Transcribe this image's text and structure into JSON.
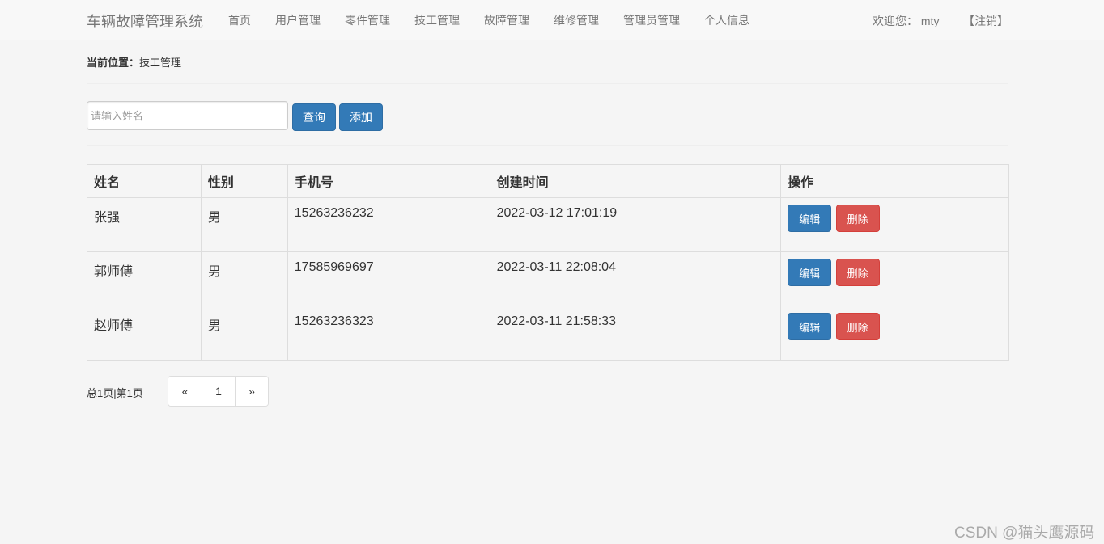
{
  "navbar": {
    "brand": "车辆故障管理系统",
    "items": [
      "首页",
      "用户管理",
      "零件管理",
      "技工管理",
      "故障管理",
      "维修管理",
      "管理员管理",
      "个人信息"
    ],
    "welcome_label": "欢迎您：",
    "username": "mty",
    "logout": "【注销】"
  },
  "breadcrumb": {
    "label": "当前位置：",
    "current": "技工管理"
  },
  "search": {
    "placeholder": "请输入姓名",
    "value": "",
    "query_label": "查询",
    "add_label": "添加"
  },
  "table": {
    "headers": [
      "姓名",
      "性别",
      "手机号",
      "创建时间",
      "操作"
    ],
    "rows": [
      {
        "name": "张强",
        "gender": "男",
        "phone": "15263236232",
        "created": "2022-03-12 17:01:19"
      },
      {
        "name": "郭师傅",
        "gender": "男",
        "phone": "17585969697",
        "created": "2022-03-11 22:08:04"
      },
      {
        "name": "赵师傅",
        "gender": "男",
        "phone": "15263236323",
        "created": "2022-03-11 21:58:33"
      }
    ],
    "edit_label": "编辑",
    "delete_label": "删除"
  },
  "pagination": {
    "info": "总1页|第1页",
    "prev": "«",
    "current": "1",
    "next": "»"
  },
  "watermark": "CSDN @猫头鹰源码",
  "colors": {
    "primary": "#337ab7",
    "danger": "#d9534f"
  }
}
